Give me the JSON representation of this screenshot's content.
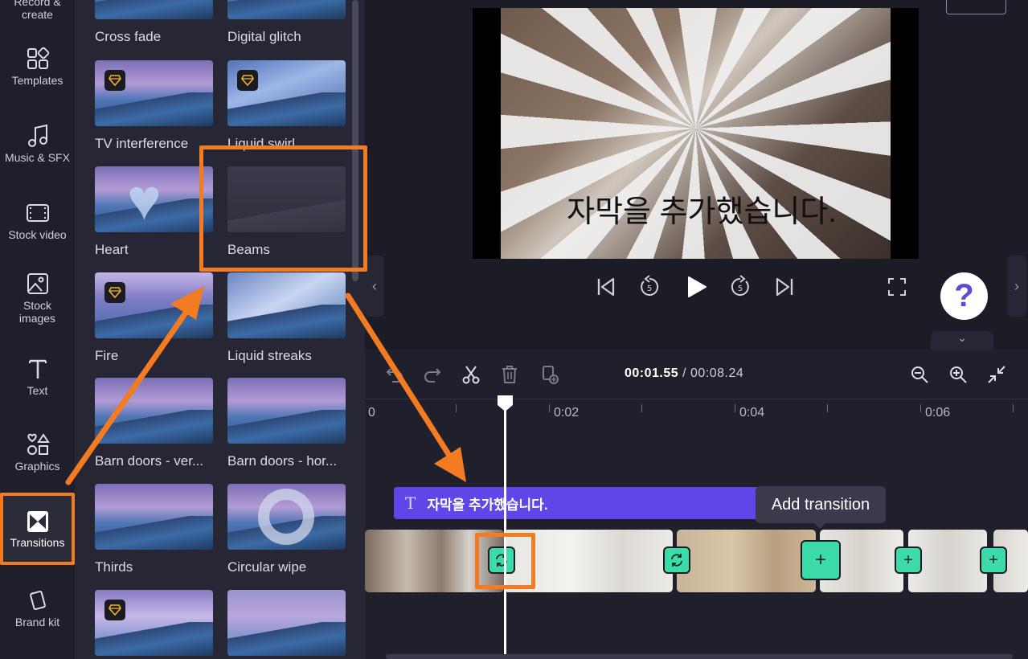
{
  "rail": {
    "items": [
      {
        "label": "Record &\ncreate",
        "icon": "record-icon"
      },
      {
        "label": "Templates",
        "icon": "templates-icon"
      },
      {
        "label": "Music & SFX",
        "icon": "music-icon"
      },
      {
        "label": "Stock video",
        "icon": "film-icon"
      },
      {
        "label": "Stock\nimages",
        "icon": "image-icon"
      },
      {
        "label": "Text",
        "icon": "text-icon"
      },
      {
        "label": "Graphics",
        "icon": "shapes-icon"
      },
      {
        "label": "Transitions",
        "icon": "transitions-icon"
      },
      {
        "label": "Brand kit",
        "icon": "brand-kit-icon"
      }
    ],
    "active": "Transitions"
  },
  "transitions": {
    "items": [
      {
        "label": "Cross fade",
        "premium": false
      },
      {
        "label": "Digital glitch",
        "premium": false
      },
      {
        "label": "TV interference",
        "premium": true
      },
      {
        "label": "Liquid swirl",
        "premium": true
      },
      {
        "label": "Heart",
        "premium": false
      },
      {
        "label": "Beams",
        "premium": false
      },
      {
        "label": "Fire",
        "premium": true
      },
      {
        "label": "Liquid streaks",
        "premium": false
      },
      {
        "label": "Barn doors - ver...",
        "premium": false
      },
      {
        "label": "Barn doors - hor...",
        "premium": false
      },
      {
        "label": "Thirds",
        "premium": false
      },
      {
        "label": "Circular wipe",
        "premium": false
      },
      {
        "label": "",
        "premium": true
      },
      {
        "label": "",
        "premium": false
      }
    ],
    "highlighted": "Beams"
  },
  "preview": {
    "subtitle": "자막을 추가했습니다.",
    "aspect_ratio": "16:9",
    "help_symbol": "?",
    "controls": [
      "skip-back-icon",
      "rewind-5-icon",
      "play-icon",
      "forward-5-icon",
      "skip-forward-icon",
      "fullscreen-icon"
    ]
  },
  "timeline": {
    "current_time": "00:01.55",
    "separator": " / ",
    "total_time": "00:08.24",
    "ruler": [
      "0",
      "0:02",
      "0:04",
      "0:06"
    ],
    "text_clip": "자막을 추가했습니다.",
    "tooltip": "Add transition",
    "add_symbol": "+"
  },
  "colors": {
    "accent_orange": "#f37b21",
    "transition_green": "#3ddbaa",
    "text_track_purple": "#6046e6"
  }
}
